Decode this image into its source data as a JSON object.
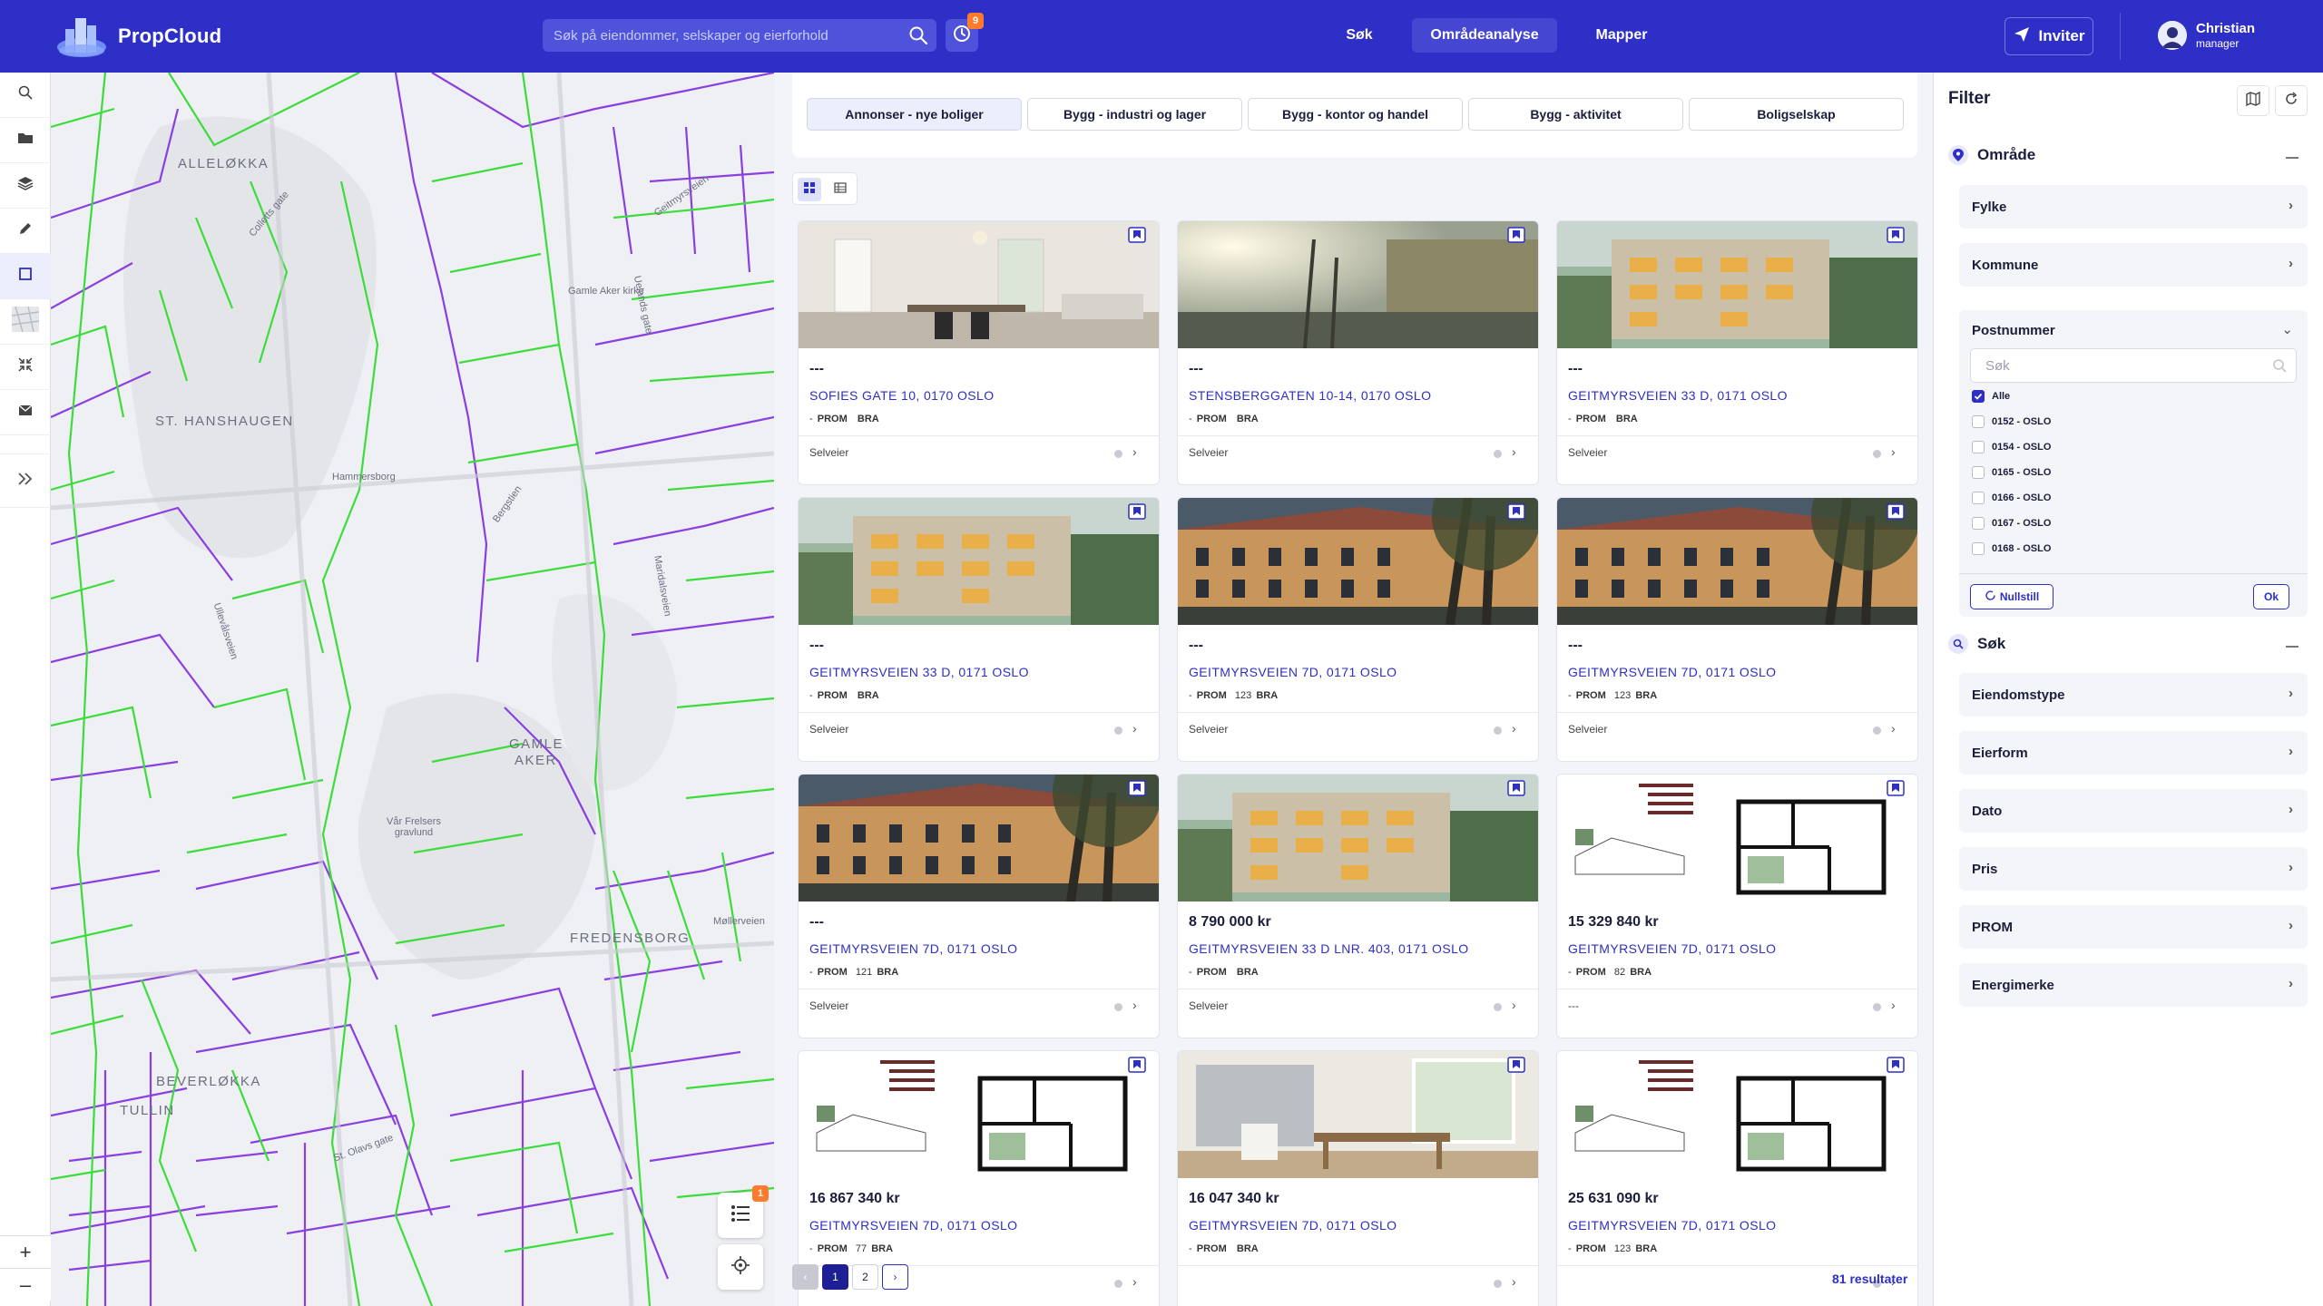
{
  "app": {
    "name": "PropCloud"
  },
  "header": {
    "search_placeholder": "Søk på eiendommer, selskaper og eierforhold",
    "history_badge": "9",
    "nav": [
      {
        "label": "Søk"
      },
      {
        "label": "Områdeanalyse",
        "active": true
      },
      {
        "label": "Mapper"
      }
    ],
    "invite_label": "Inviter",
    "user": {
      "name": "Christian",
      "role": "manager"
    }
  },
  "colors": {
    "brand": "#2d2fc6",
    "accent_badge": "#ff7a2b",
    "parcel_green": "#3ddc3d",
    "parcel_purple": "#8b3fe0"
  },
  "map": {
    "labels": {
      "l1": "ALLELØKKA",
      "l2": "ST. HANSHAUGEN",
      "l3": "GAMLE",
      "l4": "AKER",
      "l5": "Vår Frelsers gravlund",
      "l6": "FREDENSBORG",
      "l7": "BEVERLØKKA",
      "l8": "TULLIN",
      "s1": "Ullevålsveien",
      "s2": "Maridalsveien",
      "s3": "Uelands gate",
      "s4": "Colletts gate",
      "s5": "Bergstien",
      "s6": "Hammersborg",
      "s7": "Gamle Aker kirke",
      "s8": "St. Olavs gate",
      "s9": "Møllerveien",
      "s10": "Geitmyrsveien"
    },
    "legend_badge": "1",
    "zoom_in": "+",
    "zoom_out": "–"
  },
  "categories": [
    {
      "label": "Annonser - nye boliger",
      "active": true
    },
    {
      "label": "Bygg - industri og lager"
    },
    {
      "label": "Bygg - kontor og handel"
    },
    {
      "label": "Bygg - aktivitet"
    },
    {
      "label": "Boligselskap"
    }
  ],
  "prom_label": "PROM",
  "bra_label": "BRA",
  "listings": [
    {
      "price": "---",
      "address": "SOFIES GATE 10, 0170 OSLO",
      "prom": "",
      "bra": "",
      "owner": "Selveier",
      "img": "interior"
    },
    {
      "price": "---",
      "address": "STENSBERGGATEN 10-14, 0170 OSLO",
      "prom": "",
      "bra": "",
      "owner": "Selveier",
      "img": "sunset"
    },
    {
      "price": "---",
      "address": "GEITMYRSVEIEN 33 D, 0171 OSLO",
      "prom": "",
      "bra": "",
      "owner": "Selveier",
      "img": "modern"
    },
    {
      "price": "---",
      "address": "GEITMYRSVEIEN 33 D, 0171 OSLO",
      "prom": "",
      "bra": "",
      "owner": "Selveier",
      "img": "modern"
    },
    {
      "price": "---",
      "address": "GEITMYRSVEIEN 7D, 0171 OSLO",
      "prom": "",
      "bra": "123",
      "owner": "Selveier",
      "img": "classic"
    },
    {
      "price": "---",
      "address": "GEITMYRSVEIEN 7D, 0171 OSLO",
      "prom": "",
      "bra": "123",
      "owner": "Selveier",
      "img": "classic"
    },
    {
      "price": "---",
      "address": "GEITMYRSVEIEN 7D, 0171 OSLO",
      "prom": "",
      "bra": "121",
      "owner": "Selveier",
      "img": "classic"
    },
    {
      "price": "8 790 000 kr",
      "address": "GEITMYRSVEIEN 33 D LNR. 403, 0171 OSLO",
      "prom": "",
      "bra": "",
      "owner": "Selveier",
      "img": "modern"
    },
    {
      "price": "15 329 840 kr",
      "address": "GEITMYRSVEIEN 7D, 0171 OSLO",
      "prom": "",
      "bra": "82",
      "owner": "---",
      "img": "plan"
    },
    {
      "price": "16 867 340 kr",
      "address": "GEITMYRSVEIEN 7D, 0171 OSLO",
      "prom": "",
      "bra": "77",
      "owner": "",
      "img": "plan"
    },
    {
      "price": "16 047 340 kr",
      "address": "GEITMYRSVEIEN 7D, 0171 OSLO",
      "prom": "",
      "bra": "",
      "owner": "",
      "img": "dining"
    },
    {
      "price": "25 631 090 kr",
      "address": "GEITMYRSVEIEN 7D, 0171 OSLO",
      "prom": "",
      "bra": "123",
      "owner": "",
      "img": "plan"
    }
  ],
  "pagination": {
    "pages": [
      "1",
      "2"
    ],
    "current": "1",
    "prev": "‹",
    "next": "›"
  },
  "results_text": "81 resultater",
  "filter": {
    "title": "Filter",
    "omrade": {
      "title": "Område",
      "rows": [
        "Fylke",
        "Kommune"
      ]
    },
    "postnummer": {
      "title": "Postnummer",
      "search_placeholder": "Søk",
      "options": [
        {
          "label": "Alle",
          "checked": true
        },
        {
          "label": "0152 - OSLO",
          "checked": false
        },
        {
          "label": "0154 - OSLO",
          "checked": false
        },
        {
          "label": "0165 - OSLO",
          "checked": false
        },
        {
          "label": "0166 - OSLO",
          "checked": false
        },
        {
          "label": "0167 - OSLO",
          "checked": false
        },
        {
          "label": "0168 - OSLO",
          "checked": false
        }
      ],
      "reset_label": "Nullstill",
      "ok_label": "Ok"
    },
    "sok": {
      "title": "Søk",
      "rows": [
        "Eiendomstype",
        "Eierform",
        "Dato",
        "Pris",
        "PROM",
        "Energimerke"
      ]
    }
  }
}
